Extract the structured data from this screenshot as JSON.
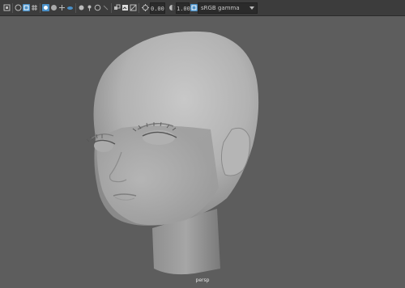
{
  "toolbar": {
    "exposure_value": "0.00",
    "gamma_value": "1.00",
    "color_space": "sRGB gamma",
    "icons": [
      "camera-attributes-icon",
      "bookmarks-icon",
      "image-plane-icon",
      "grid-icon",
      "film-gate-icon",
      "resolution-gate-icon",
      "gate-mask-icon",
      "field-chart-icon",
      "safe-action-icon",
      "wireframe-icon",
      "smooth-shade-icon",
      "textured-icon",
      "lights-icon",
      "shadows-icon",
      "ambient-occlusion-icon",
      "motion-blur-icon",
      "anti-alias-icon",
      "depth-of-field-icon",
      "isolate-icon",
      "xray-icon",
      "xray-joints-icon",
      "backface-icon"
    ]
  },
  "viewport": {
    "camera_label": "persp"
  },
  "colors": {
    "toolbar_bg": "#3c3c3c",
    "viewport_bg": "#5d5d5d",
    "active_icon": "#4a90c8"
  }
}
